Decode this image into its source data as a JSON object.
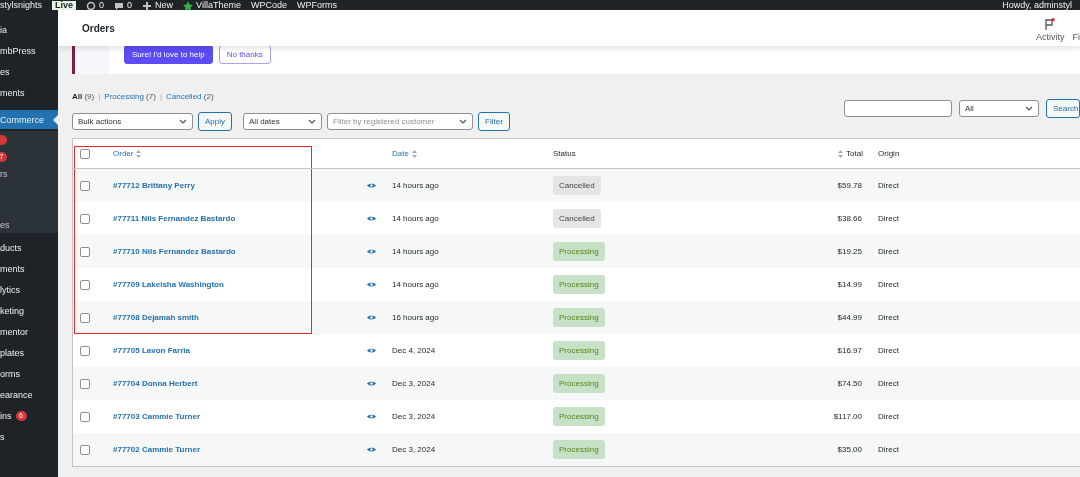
{
  "admin_bar": {
    "items": [
      {
        "kind": "site",
        "label": "stylsnights"
      },
      {
        "kind": "badge",
        "label": "Live"
      },
      {
        "kind": "updates",
        "label": "0"
      },
      {
        "kind": "comments",
        "label": "0"
      },
      {
        "kind": "new",
        "label": "New"
      },
      {
        "kind": "plugin",
        "label": "VillaTheme"
      },
      {
        "kind": "text",
        "label": "WPCode"
      },
      {
        "kind": "text",
        "label": "WPForms"
      }
    ],
    "greeting": "Howdy, adminstyl"
  },
  "sidebar": {
    "items": [
      {
        "label": "ia",
        "current": false,
        "submenu": false
      },
      {
        "label": "mbPress",
        "current": false,
        "submenu": false
      },
      {
        "label": "es",
        "current": false,
        "submenu": false
      },
      {
        "label": "ments",
        "current": false,
        "submenu": false
      },
      {
        "label": "Commerce",
        "current": true,
        "submenu": false
      },
      {
        "kind": "badge-dot",
        "current": false,
        "submenu": true
      },
      {
        "badge": "7",
        "current": false,
        "submenu": true
      },
      {
        "label": "rs",
        "current": false,
        "submenu": true
      },
      {
        "kind": "blank",
        "current": false,
        "submenu": true
      },
      {
        "kind": "blank",
        "current": false,
        "submenu": true
      },
      {
        "label": "es",
        "current": false,
        "submenu": true
      },
      {
        "label": "ducts",
        "current": false,
        "submenu": false
      },
      {
        "label": "ments",
        "current": false,
        "submenu": false
      },
      {
        "label": "lytics",
        "current": false,
        "submenu": false
      },
      {
        "label": "keting",
        "current": false,
        "submenu": false
      },
      {
        "label": "mentor",
        "current": false,
        "submenu": false
      },
      {
        "label": "plates",
        "current": false,
        "submenu": false
      },
      {
        "label": "orms",
        "current": false,
        "submenu": false
      },
      {
        "label": "earance",
        "current": false,
        "submenu": false
      },
      {
        "label": "ins",
        "badge": "6",
        "current": false,
        "submenu": false
      },
      {
        "label": "s",
        "current": false,
        "submenu": false
      }
    ]
  },
  "header": {
    "title": "Orders",
    "tools": [
      {
        "label": "Activity"
      },
      {
        "label": "Fi"
      }
    ]
  },
  "notice": {
    "buttons": [
      {
        "label": "Sure! I'd love to help",
        "kind": "primary"
      },
      {
        "label": "No thanks",
        "kind": "secondary"
      }
    ]
  },
  "views": [
    {
      "label": "All",
      "count": "(9)",
      "selected": true
    },
    {
      "separator": "|",
      "label": "Processing",
      "count": "(7)",
      "selected": false
    },
    {
      "separator": "|",
      "label": "Cancelled",
      "count": "(2)",
      "selected": false
    }
  ],
  "search": {
    "scope": "All",
    "button": "Search"
  },
  "filters": {
    "bulk": "Bulk actions",
    "apply": "Apply",
    "dates": "All dates",
    "customer_placeholder": "Filter by registered customer",
    "filter": "Filter"
  },
  "table": {
    "select_all": {
      "checked": false,
      "highlighted": true
    },
    "columns": [
      "Order",
      "Date",
      "Status",
      "Total",
      "Origin"
    ],
    "rows": [
      {
        "order": "#77712 Brittany Perry",
        "date": "14 hours ago",
        "status": "Cancelled",
        "kind": "cancelled",
        "total": "$59.78",
        "origin": "Direct",
        "checked": false,
        "highlighted": true
      },
      {
        "order": "#77711 Nils Fernandez Bastardo",
        "date": "14 hours ago",
        "status": "Cancelled",
        "kind": "cancelled",
        "total": "$38.66",
        "origin": "Direct",
        "checked": false,
        "highlighted": true
      },
      {
        "order": "#77710 Nils Fernandez Bastardo",
        "date": "14 hours ago",
        "status": "Processing",
        "kind": "processing",
        "total": "$19.25",
        "origin": "Direct",
        "checked": false,
        "highlighted": true
      },
      {
        "order": "#77709 Lakeisha Washington",
        "date": "14 hours ago",
        "status": "Processing",
        "kind": "processing",
        "total": "$14.99",
        "origin": "Direct",
        "checked": false,
        "highlighted": true
      },
      {
        "order": "#77708 Dejamah smith",
        "date": "16 hours ago",
        "status": "Processing",
        "kind": "processing",
        "total": "$44.99",
        "origin": "Direct",
        "checked": false,
        "highlighted": true
      },
      {
        "order": "#77705 Lavon Farria",
        "date": "Dec 4, 2024",
        "status": "Processing",
        "kind": "processing",
        "total": "$16.97",
        "origin": "Direct",
        "checked": false,
        "highlighted": false
      },
      {
        "order": "#77704 Donna Herbert",
        "date": "Dec 3, 2024",
        "status": "Processing",
        "kind": "processing",
        "total": "$74.50",
        "origin": "Direct",
        "checked": false,
        "highlighted": false
      },
      {
        "order": "#77703 Cammie Turner",
        "date": "Dec 3, 2024",
        "status": "Processing",
        "kind": "processing",
        "total": "$117.00",
        "origin": "Direct",
        "checked": false,
        "highlighted": false
      },
      {
        "order": "#77702 Cammie Turner",
        "date": "Dec 3, 2024",
        "status": "Processing",
        "kind": "processing",
        "total": "$35.00",
        "origin": "Direct",
        "checked": false,
        "highlighted": false
      }
    ]
  }
}
